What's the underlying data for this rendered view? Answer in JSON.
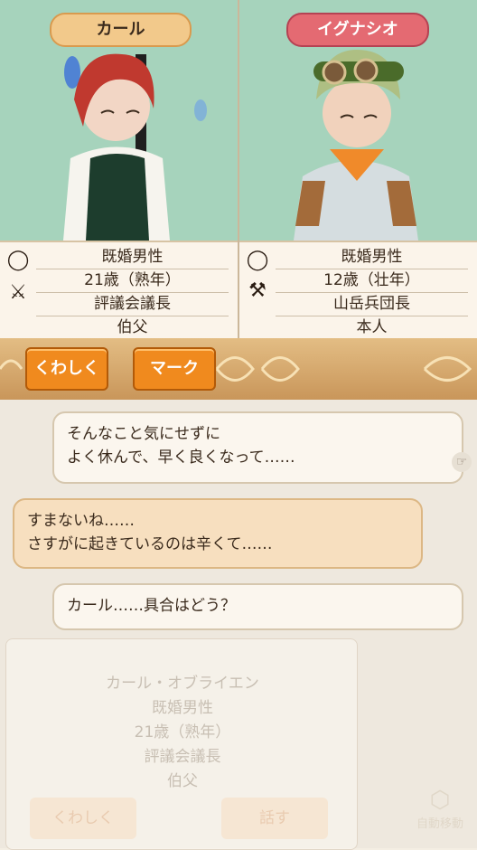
{
  "left": {
    "name": "カール",
    "rows": [
      "既婚男性",
      "21歳（熟年）",
      "評議会議長",
      "伯父"
    ]
  },
  "right": {
    "name": "イグナシオ",
    "rows": [
      "既婚男性",
      "12歳（壮年）",
      "山岳兵団長",
      "本人"
    ]
  },
  "buttons": {
    "detail": "くわしく",
    "mark": "マーク"
  },
  "chat": [
    {
      "line1": "そんなこと気にせずに",
      "line2": "よく休んで、早く良くなって……"
    },
    {
      "line1": "すまないね……",
      "line2": "さすがに起きているのは辛くて……"
    },
    {
      "line1": "カール……具合はどう？"
    }
  ],
  "card": {
    "fullname": "カール・オブライエン",
    "rows": [
      "既婚男性",
      "21歳（熟年）",
      "評議会議長",
      "伯父"
    ],
    "detail": "くわしく",
    "talk": "話す",
    "auto": "自動移動"
  },
  "colors": {
    "portrait_bg": "#a6d3bc",
    "tag_left": "#f2c98b",
    "tag_right": "#e46a72",
    "button": "#f08a1e"
  },
  "icons": [
    "ring-icon",
    "crossed-swords-icon",
    "axe-icon",
    "speech-icon"
  ]
}
